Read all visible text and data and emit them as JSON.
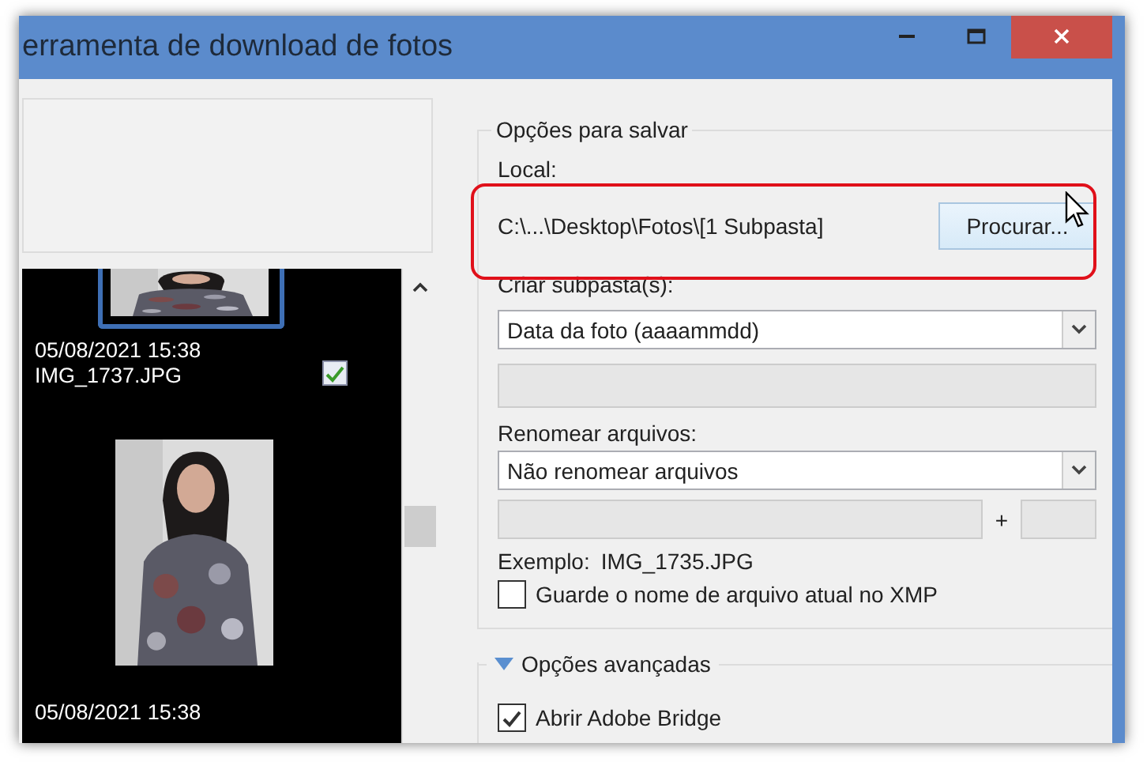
{
  "window": {
    "title": "erramenta de download de fotos"
  },
  "preview_list": {
    "items": [
      {
        "date": "05/08/2021 15:38",
        "filename": "IMG_1737.JPG",
        "checked": true,
        "selected": true
      },
      {
        "date": "05/08/2021 15:38",
        "selected": false
      }
    ]
  },
  "save_options": {
    "title": "Opções para salvar",
    "location_label": "Local:",
    "location_path": "C:\\...\\Desktop\\Fotos\\[1 Subpasta]",
    "browse_button": "Procurar...",
    "subfolder_label": "Criar subpasta(s):",
    "subfolder_value": "Data da foto (aaaammdd)",
    "rename_label": "Renomear arquivos:",
    "rename_value": "Não renomear arquivos",
    "plus": "+",
    "example_label": "Exemplo:",
    "example_value": "IMG_1735.JPG",
    "keep_name": {
      "label": "Guarde o nome de arquivo atual no XMP",
      "checked": false
    }
  },
  "advanced_options": {
    "title": "Opções avançadas",
    "expanded": true,
    "open_bridge": {
      "label": "Abrir Adobe Bridge",
      "checked": true
    }
  }
}
